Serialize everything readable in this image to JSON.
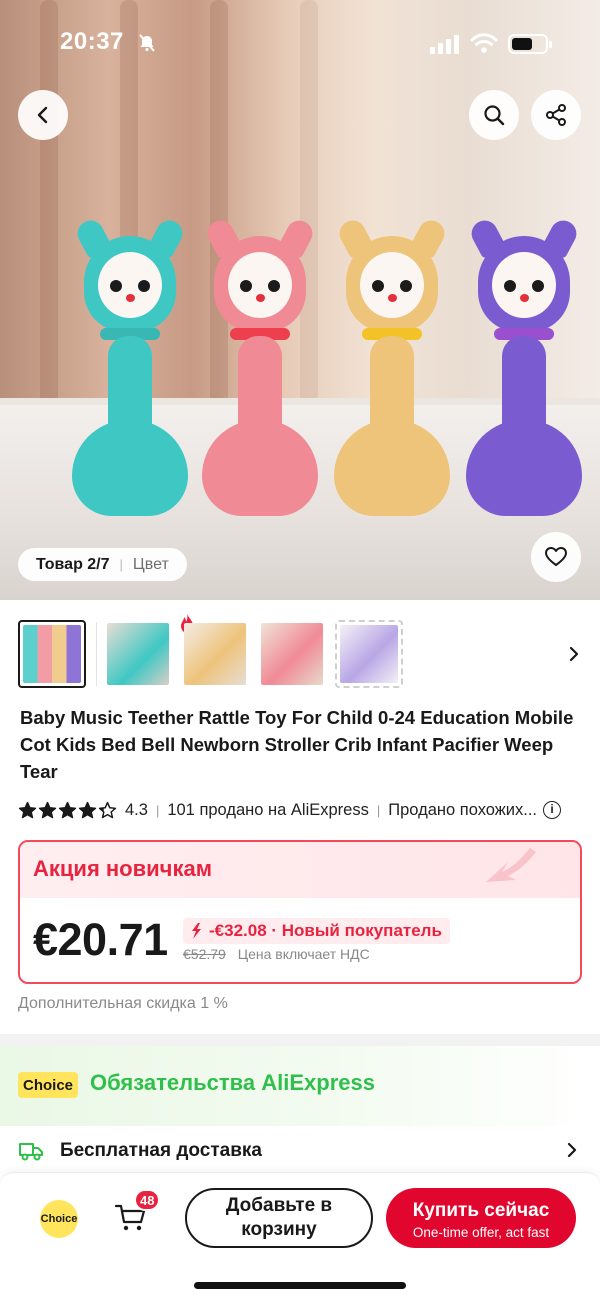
{
  "status_bar": {
    "time": "20:37"
  },
  "gallery": {
    "counter_label": "Товар 2/7",
    "color_label": "Цвет",
    "toy_colors": [
      "#3fc7c4",
      "#f08a95",
      "#eec37a",
      "#7b5bd0"
    ]
  },
  "product": {
    "title": "Baby Music Teether Rattle Toy For Child 0-24 Education Mobile Cot Kids Bed Bell Newborn Stroller Crib Infant Pacifier Weep Tear",
    "rating_value": "4.3",
    "rating_stars": 4.3,
    "sold_text": "101 продано на AliExpress",
    "similar_text": "Продано похожих..."
  },
  "promo": {
    "title": "Акция новичкам",
    "price": "€20.71",
    "discount": "-€32.08 · Новый покупатель",
    "old_price": "€52.79",
    "vat_note": "Цена включает НДС"
  },
  "extra_discount": "Дополнительная скидка 1 %",
  "commitments": {
    "badge": "Choice",
    "title": "Обязательства AliExpress"
  },
  "delivery": {
    "label": "Бесплатная доставка"
  },
  "bottom_bar": {
    "choice_label": "Choice",
    "cart_count": "48",
    "add_to_cart": "Добавьте в корзину",
    "buy_now": "Купить сейчас",
    "buy_now_sub": "One-time offer, act fast"
  },
  "colors": {
    "accent_red": "#e8233f",
    "buy_button": "#e1062d",
    "choice_yellow": "#ffe45c",
    "choice_green": "#2fbf4a"
  }
}
